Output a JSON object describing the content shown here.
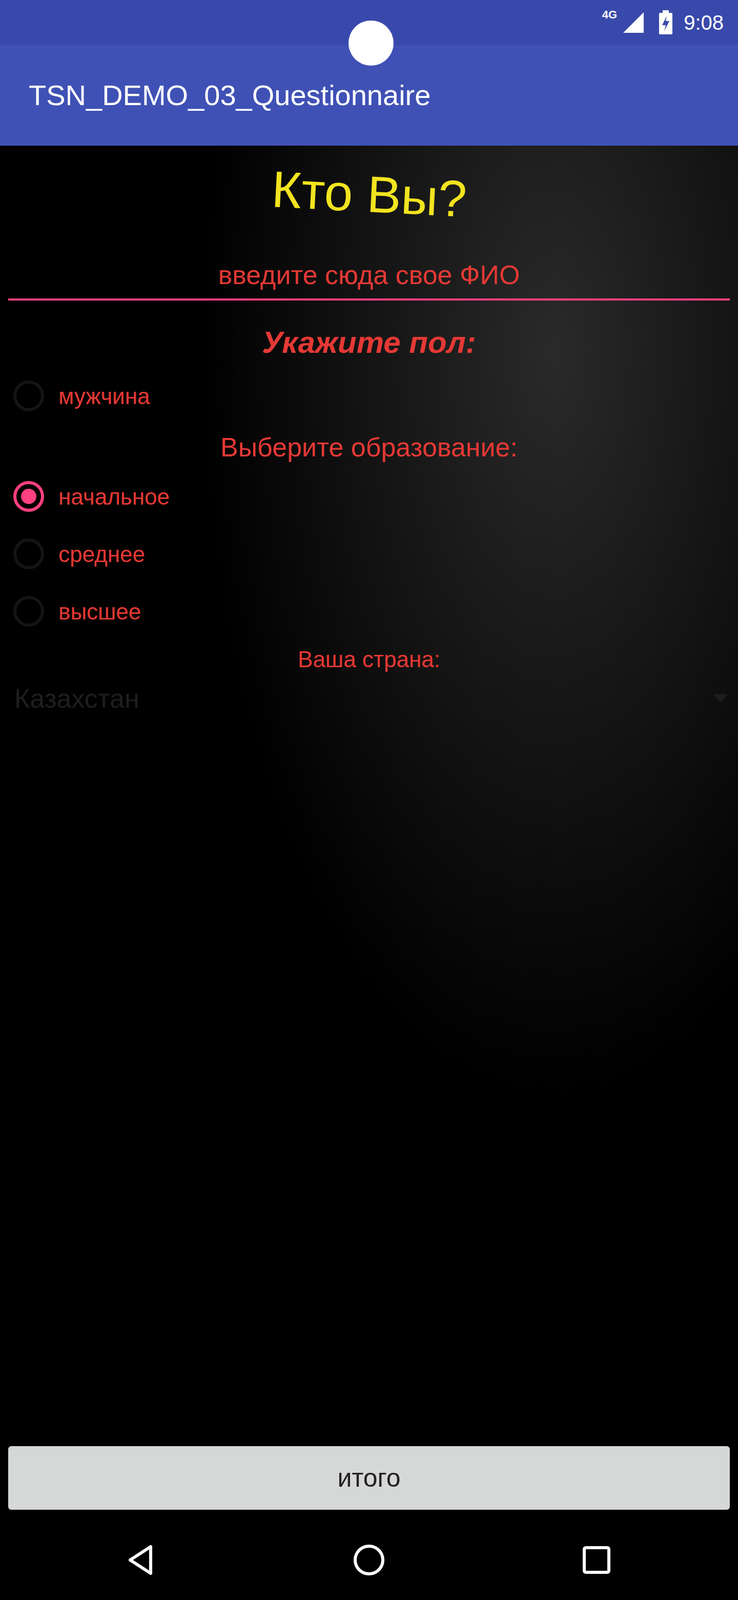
{
  "status_bar": {
    "network": "4G",
    "time": "9:08"
  },
  "app_bar": {
    "title": "TSN_DEMO_03_Questionnaire"
  },
  "heading": "Кто Вы?",
  "name_field": {
    "placeholder": "введите сюда свое ФИО"
  },
  "gender": {
    "label": "Укажите пол:",
    "options": [
      {
        "label": "мужчина",
        "selected": false
      }
    ]
  },
  "education": {
    "label": "Выберите образование:",
    "options": [
      {
        "label": "начальное",
        "selected": true
      },
      {
        "label": "среднее",
        "selected": false
      },
      {
        "label": "высшее",
        "selected": false
      }
    ]
  },
  "country": {
    "label": "Ваша страна:",
    "value": "Казахстан"
  },
  "buttons": [
    "итого"
  ]
}
